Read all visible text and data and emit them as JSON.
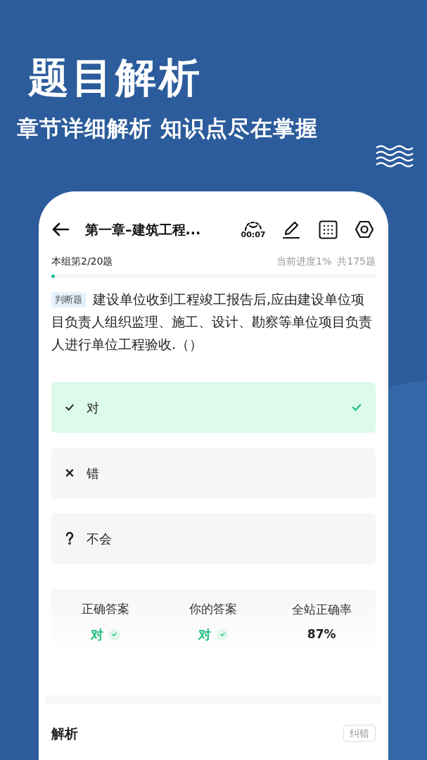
{
  "headline": "题目解析",
  "subheadline": "章节详细解析 知识点尽在掌握",
  "header": {
    "title": "第一章–建筑工程...",
    "timer": "00:07"
  },
  "progress": {
    "group_label": "本组第2/20题",
    "overall_label": "当前进度1%",
    "total_label": "共175题",
    "level": 0.01
  },
  "question": {
    "type_tag": "判断题",
    "text": "建设单位收到工程竣工报告后,应由建设单位项目负责人组织监理、施工、设计、勘察等单位项目负责人进行单位工程验收.（）"
  },
  "options": [
    {
      "kind": "check",
      "label": "对",
      "selected": true
    },
    {
      "kind": "cross",
      "label": "错",
      "selected": false
    },
    {
      "kind": "question",
      "label": "不会",
      "selected": false
    }
  ],
  "stats": [
    {
      "kind": "answer",
      "title": "正确答案",
      "value": "对",
      "correct": true
    },
    {
      "kind": "answer",
      "title": "你的答案",
      "value": "对",
      "correct": true
    },
    {
      "kind": "rate",
      "title": "全站正确率",
      "value": "87%"
    }
  ],
  "analysis": {
    "title": "解析",
    "report_button": "纠错"
  }
}
